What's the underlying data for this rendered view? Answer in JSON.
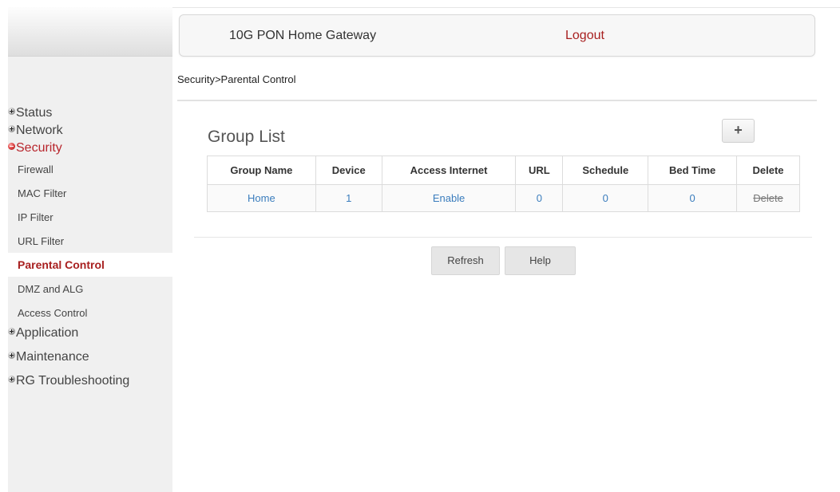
{
  "header": {
    "title": "10G PON Home Gateway",
    "logout_label": "Logout"
  },
  "breadcrumb": "Security>Parental Control",
  "sidebar": {
    "sections": [
      {
        "label": "Status",
        "expanded": false
      },
      {
        "label": "Network",
        "expanded": false
      },
      {
        "label": "Security",
        "expanded": true,
        "items": [
          "Firewall",
          "MAC Filter",
          "IP Filter",
          "URL Filter",
          "Parental Control",
          "DMZ and ALG",
          "Access Control"
        ],
        "active_item": "Parental Control"
      },
      {
        "label": "Application",
        "expanded": false
      },
      {
        "label": "Maintenance",
        "expanded": false
      },
      {
        "label": "RG Troubleshooting",
        "expanded": false
      }
    ]
  },
  "main": {
    "group_list_title": "Group List",
    "add_button_label": "+",
    "table": {
      "columns": [
        "Group Name",
        "Device",
        "Access Internet",
        "URL",
        "Schedule",
        "Bed Time",
        "Delete"
      ],
      "rows": [
        [
          "Home",
          "1",
          "Enable",
          "0",
          "0",
          "0",
          "Delete"
        ]
      ]
    },
    "refresh_label": "Refresh",
    "help_label": "Help"
  },
  "colors": {
    "accent": "#a82020",
    "link": "#3b7dbd",
    "sidebar_bg": "#f0f0f0"
  }
}
